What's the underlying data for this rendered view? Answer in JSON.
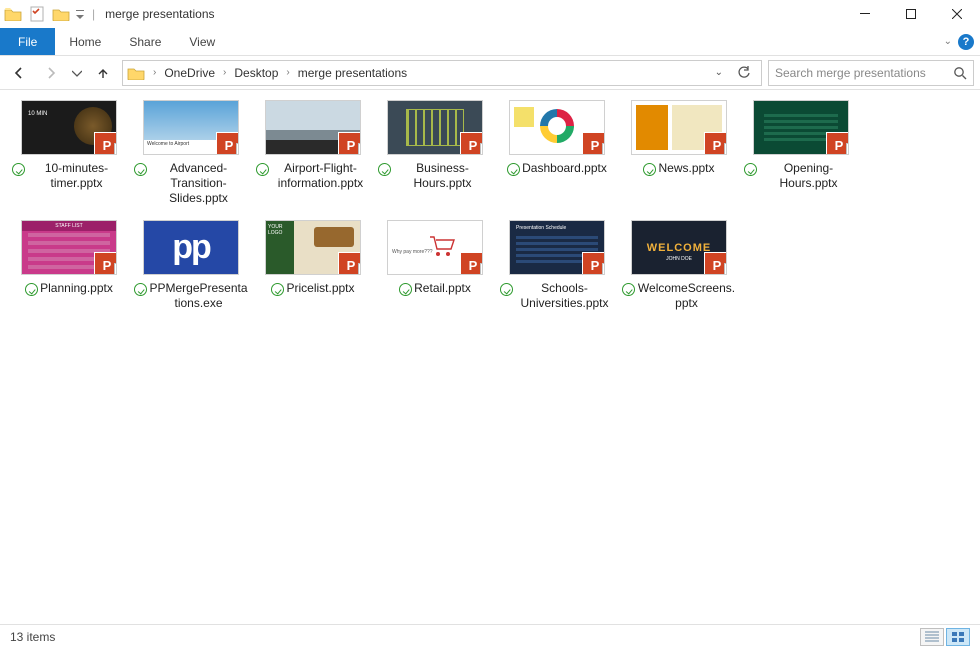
{
  "window": {
    "title": "merge presentations"
  },
  "ribbon": {
    "file": "File",
    "tabs": [
      "Home",
      "Share",
      "View"
    ]
  },
  "breadcrumb": {
    "items": [
      "OneDrive",
      "Desktop",
      "merge presentations"
    ]
  },
  "search": {
    "placeholder": "Search merge presentations"
  },
  "files": [
    {
      "name": "10-minutes-timer.pptx",
      "type": "pptx",
      "thumb": "t-dark",
      "mini": "10 MIN"
    },
    {
      "name": "Advanced-Transition-Slides.pptx",
      "type": "pptx",
      "thumb": "t-adv"
    },
    {
      "name": "Airport-Flight-information.pptx",
      "type": "pptx",
      "thumb": "t-air"
    },
    {
      "name": "Business-Hours.pptx",
      "type": "pptx",
      "thumb": "t-bus"
    },
    {
      "name": "Dashboard.pptx",
      "type": "pptx",
      "thumb": "t-dash"
    },
    {
      "name": "News.pptx",
      "type": "pptx",
      "thumb": "t-news"
    },
    {
      "name": "Opening-Hours.pptx",
      "type": "pptx",
      "thumb": "t-open"
    },
    {
      "name": "Planning.pptx",
      "type": "pptx",
      "thumb": "t-plan",
      "hdr": "STAFF LIST"
    },
    {
      "name": "PPMergePresentations.exe",
      "type": "exe",
      "thumb": "exe"
    },
    {
      "name": "Pricelist.pptx",
      "type": "pptx",
      "thumb": "t-price"
    },
    {
      "name": "Retail.pptx",
      "type": "pptx",
      "thumb": "t-retail",
      "txt": "Why pay more???"
    },
    {
      "name": "Schools-Universities.pptx",
      "type": "pptx",
      "thumb": "t-sch",
      "hdr": "Presentation Schedule"
    },
    {
      "name": "WelcomeScreens.pptx",
      "type": "pptx",
      "thumb": "t-wel",
      "wtext": "WELCOME",
      "sub": "JOHN DOE"
    }
  ],
  "status": {
    "count": "13 items"
  }
}
